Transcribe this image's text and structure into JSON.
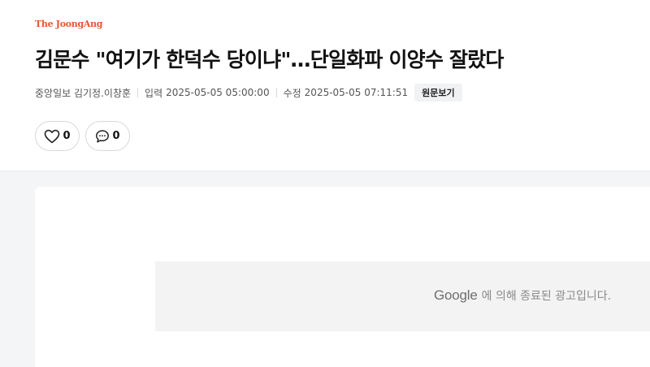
{
  "publisher": "The JoongAng",
  "article": {
    "title": "김문수 \"여기가 한덕수 당이냐\"…단일화파 이양수 잘랐다",
    "source": "중앙일보 김기정.이창훈",
    "published_label": "입력",
    "published": "2025-05-05 05:00:00",
    "modified_label": "수정",
    "modified": "2025-05-05 07:11:51",
    "original_label": "원문보기"
  },
  "actions": {
    "like_count": "0",
    "comment_count": "0"
  },
  "ad": {
    "google": "Google",
    "text": "에 의해 종료된 광고입니다."
  },
  "colors": {
    "brand": "#e8552d",
    "background": "#f4f5f7"
  },
  "icons": [
    "heart-icon",
    "comment-icon"
  ]
}
